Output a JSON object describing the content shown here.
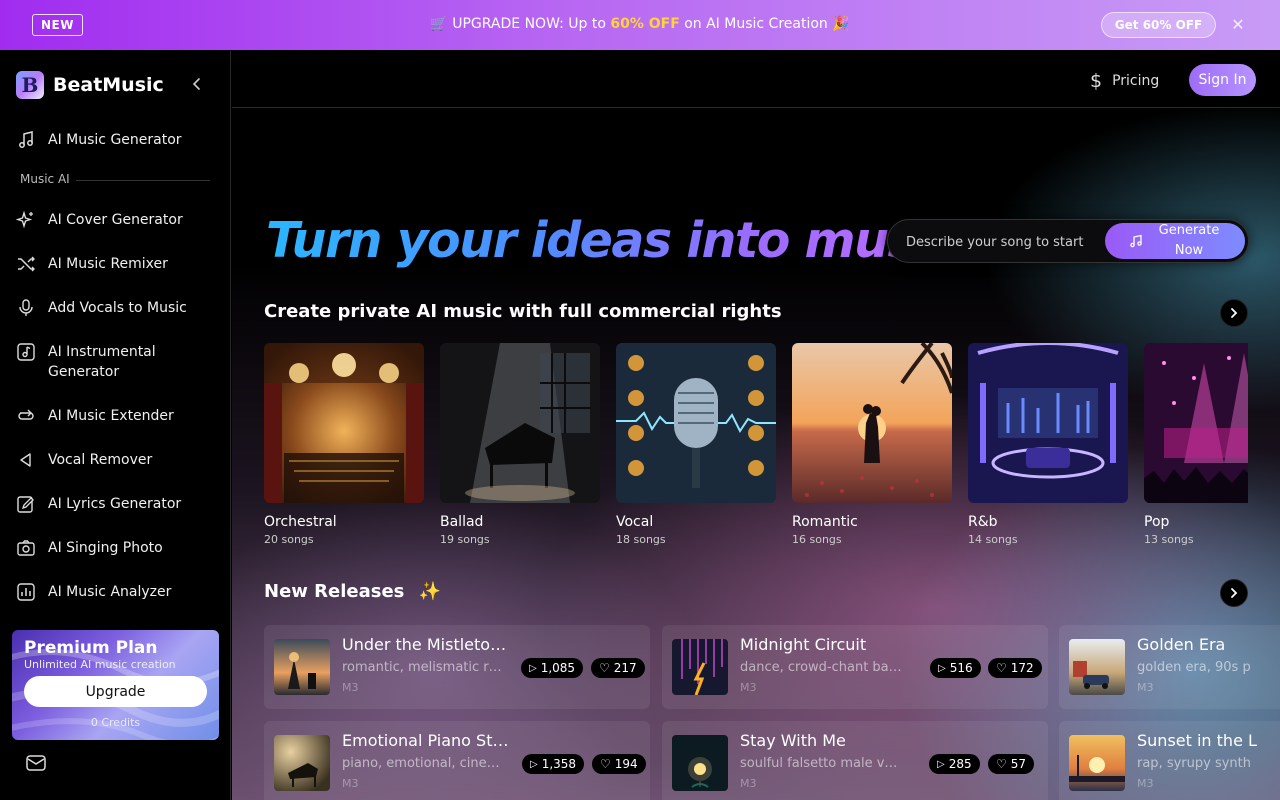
{
  "promo": {
    "badge": "NEW",
    "emoji_left": "🛒",
    "text_before": "UPGRADE NOW: Up to",
    "highlight": "60% OFF",
    "text_after": "on AI Music Creation",
    "emoji_right": "🎉",
    "cta": "Get 60% OFF",
    "close_icon": "close-icon"
  },
  "brand": {
    "logo_letter": "B",
    "name": "BeatMusic"
  },
  "sidebar": {
    "section_label": "Music AI",
    "items": [
      {
        "label": "AI Music Generator",
        "icon": "music-note-icon"
      },
      {
        "label": "AI Cover Generator",
        "icon": "sparkles-icon"
      },
      {
        "label": "AI Music Remixer",
        "icon": "shuffle-icon"
      },
      {
        "label": "Add Vocals to Music",
        "icon": "microphone-icon"
      },
      {
        "label": "AI Instrumental Generator",
        "icon": "instrument-icon"
      },
      {
        "label": "AI Music Extender",
        "icon": "loop-icon"
      },
      {
        "label": "Vocal Remover",
        "icon": "speaker-icon"
      },
      {
        "label": "AI Lyrics Generator",
        "icon": "pen-icon"
      },
      {
        "label": "AI Singing Photo",
        "icon": "camera-icon"
      },
      {
        "label": "AI Music Analyzer",
        "icon": "chart-icon"
      }
    ],
    "premium": {
      "title": "Premium Plan",
      "subtitle": "Unlimited AI music creation",
      "button": "Upgrade",
      "credits": "0 Credits"
    }
  },
  "header": {
    "pricing": "Pricing",
    "signin": "Sign In"
  },
  "hero": {
    "title": "Turn your ideas into music",
    "placeholder": "Describe your song to start",
    "generate": "Generate Now"
  },
  "genres_section": {
    "title": "Create private AI music with full commercial rights",
    "items": [
      {
        "name": "Orchestral",
        "count": "20 songs"
      },
      {
        "name": "Ballad",
        "count": "19 songs"
      },
      {
        "name": "Vocal",
        "count": "18 songs"
      },
      {
        "name": "Romantic",
        "count": "16 songs"
      },
      {
        "name": "R&b",
        "count": "14 songs"
      },
      {
        "name": "Pop",
        "count": "13 songs"
      }
    ]
  },
  "releases_section": {
    "title": "New Releases",
    "emoji": "✨",
    "items": [
      {
        "title": "Under the Mistletoe ...",
        "tags": "romantic, melismatic ru...",
        "model": "M3",
        "plays": "1,085",
        "likes": "217"
      },
      {
        "title": "Midnight Circuit",
        "tags": "dance, crowd-chant back...",
        "model": "M3",
        "plays": "516",
        "likes": "172"
      },
      {
        "title": "Golden Era",
        "tags": "golden era, 90s p",
        "model": "M3"
      },
      {
        "title": "Emotional Piano Story",
        "tags": "piano, emotional, cinem...",
        "model": "M3",
        "plays": "1,358",
        "likes": "194"
      },
      {
        "title": "Stay With Me",
        "tags": "soulful falsetto male vocal...",
        "model": "M3",
        "plays": "285",
        "likes": "57"
      },
      {
        "title": "Sunset in the L",
        "tags": "rap, syrupy synth",
        "model": "M3"
      }
    ]
  }
}
